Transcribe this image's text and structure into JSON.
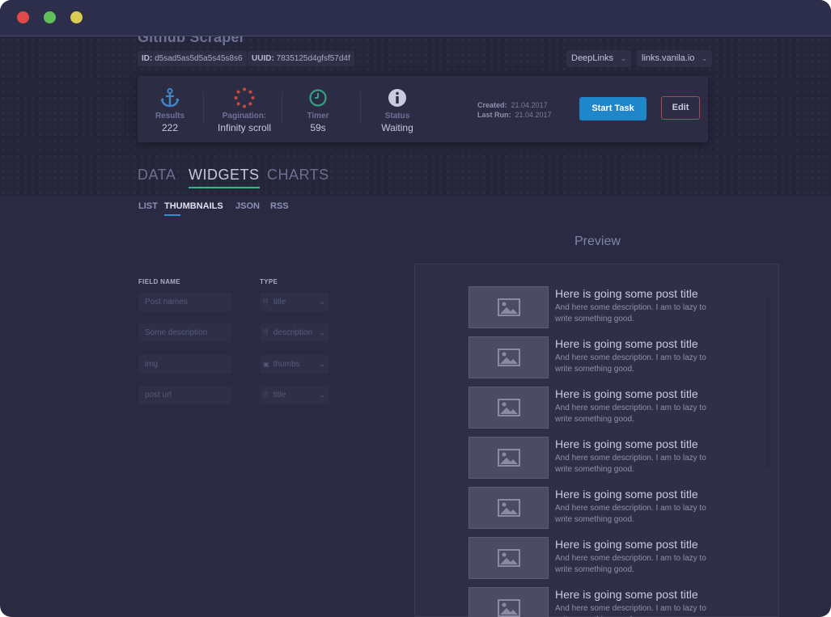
{
  "window": {
    "title": "Github Scraper"
  },
  "ids": {
    "id_label": "ID:",
    "id_value": "d5sad5as5d5a5s45s8s6",
    "uuid_label": "UUID:",
    "uuid_value": "7835125d4gfsf57d4f"
  },
  "top_dropdowns": [
    {
      "value": "DeepLinks"
    },
    {
      "value": "links.vanila.io"
    }
  ],
  "stats": [
    {
      "icon": "anchor-icon",
      "label": "Results",
      "value": "222"
    },
    {
      "icon": "loading-dots-icon",
      "label": "Pagination:",
      "value": "Infinity scroll"
    },
    {
      "icon": "clock-icon",
      "label": "Timer",
      "value": "59s"
    },
    {
      "icon": "info-icon",
      "label": "Status",
      "value": "Waiting"
    }
  ],
  "dates": {
    "created_label": "Created:",
    "created_value": "21.04.2017",
    "last_run_label": "Last Run:",
    "last_run_value": "21.04.2017"
  },
  "actions": {
    "start_label": "Start Task",
    "edit_label": "Edit"
  },
  "main_tabs": [
    {
      "label": "DATA",
      "active": false
    },
    {
      "label": "WIDGETS",
      "active": true
    },
    {
      "label": "CHARTS",
      "active": false
    }
  ],
  "sub_tabs": [
    {
      "label": "LIST",
      "active": false
    },
    {
      "label": "THUMBNAILS",
      "active": true
    },
    {
      "label": "JSON",
      "active": false
    },
    {
      "label": "RSS",
      "active": false
    }
  ],
  "fields_table": {
    "field_header": "FIELD NAME",
    "type_header": "TYPE",
    "rows": [
      {
        "field_placeholder": "Post names",
        "type": "title",
        "type_icon": "document-icon"
      },
      {
        "field_placeholder": "Some description",
        "type": "description",
        "type_icon": "document-icon"
      },
      {
        "field_placeholder": "img",
        "type": "thumbs",
        "type_icon": "image-icon"
      },
      {
        "field_placeholder": "post url",
        "type": "title",
        "type_icon": "document-icon"
      }
    ]
  },
  "preview": {
    "title": "Preview",
    "post_title": "Here is going some post title",
    "post_desc": "And here some description. I am to lazy to write something good.",
    "items": 7
  },
  "colors": {
    "accent_blue": "#1f86c9",
    "tab_underline": "#38b38b",
    "edit_border": "#b54452",
    "window_bg": "#2a2b42"
  }
}
